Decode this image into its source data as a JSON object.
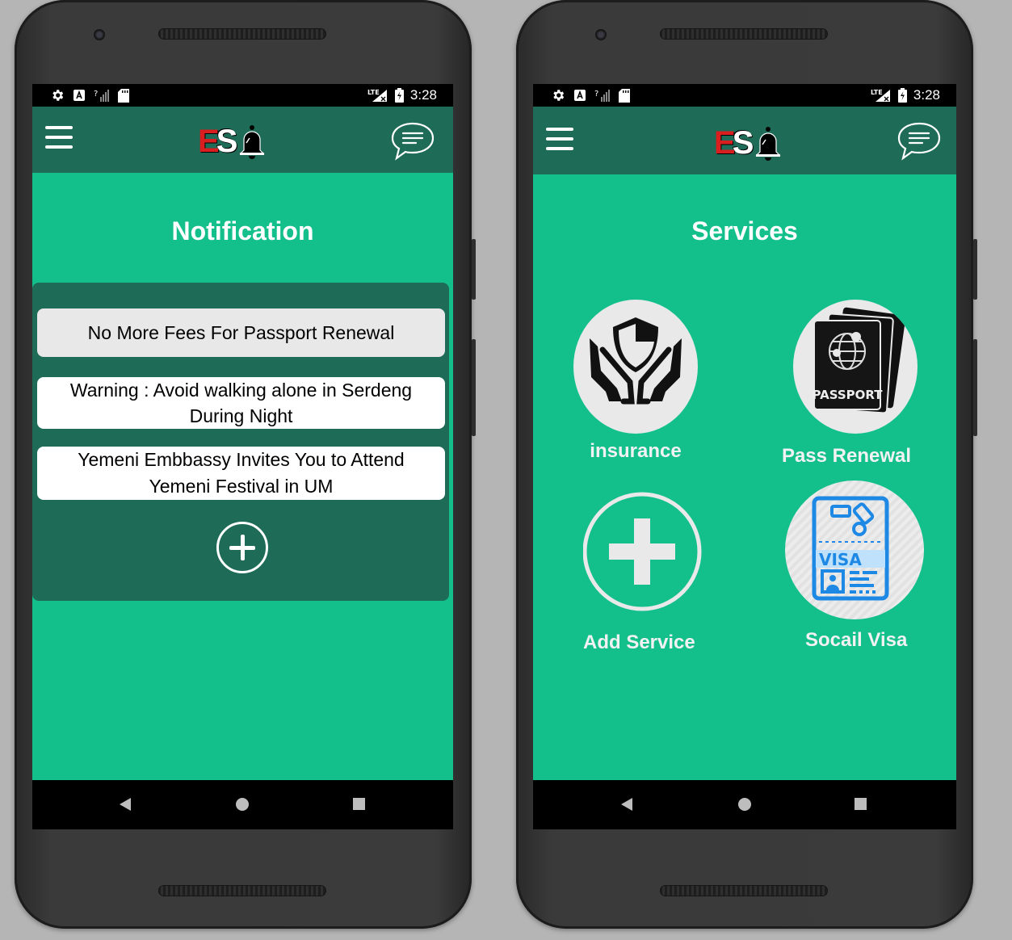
{
  "status_bar": {
    "time": "3:28",
    "network": "LTE"
  },
  "app": {
    "logo_text_e": "E",
    "logo_text_s": "S"
  },
  "notification_screen": {
    "title": "Notification",
    "items": [
      {
        "line1": "No More Fees For Passport Renewal",
        "line2": ""
      },
      {
        "line1": "Warning : Avoid walking alone in Serdeng",
        "line2": "During Night"
      },
      {
        "line1": "Yemeni Embbassy Invites You to Attend",
        "line2": "Yemeni Festival in UM"
      }
    ]
  },
  "services_screen": {
    "title": "Services",
    "services": [
      {
        "label": "insurance",
        "icon": "insurance-shield-hands-icon"
      },
      {
        "label": "Pass Renewal",
        "icon": "passport-icon",
        "icon_text": "PASSPORT"
      },
      {
        "label": "Add Service",
        "icon": "add-circle-icon"
      },
      {
        "label": "Socail Visa",
        "icon": "visa-document-icon",
        "icon_text": "VISA"
      }
    ]
  },
  "colors": {
    "screen_bg": "#13c08c",
    "appbar_bg": "#1e6b58",
    "logo_red": "#d81e1e"
  }
}
